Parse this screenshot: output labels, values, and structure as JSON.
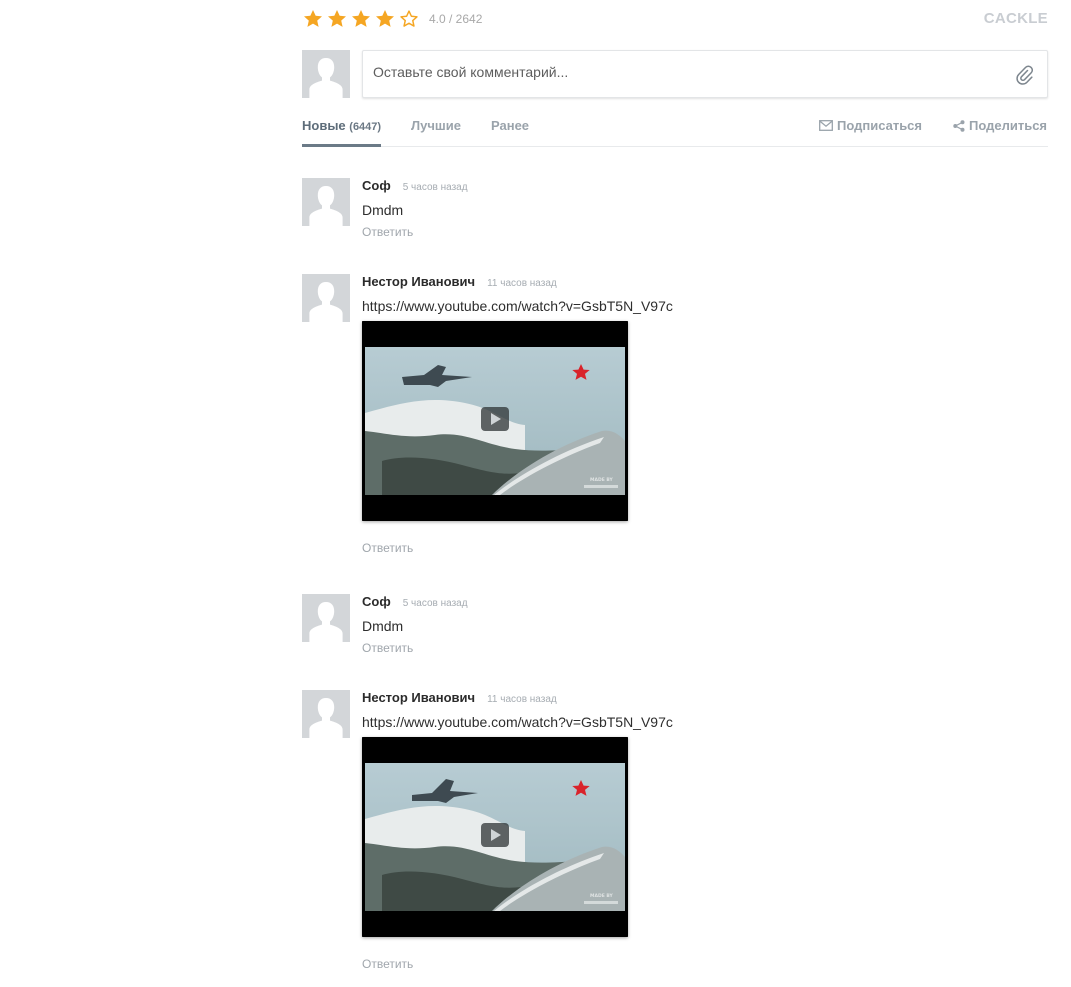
{
  "rating": {
    "value": 4,
    "max": 5,
    "text": "4.0 / 2642"
  },
  "brand": "CACKLE",
  "composer": {
    "placeholder": "Оставьте свой комментарий..."
  },
  "tabs": {
    "new_label": "Новые",
    "new_count": "(6447)",
    "best_label": "Лучшие",
    "earlier_label": "Ранее",
    "subscribe_label": "Подписаться",
    "share_label": "Поделиться"
  },
  "comments": [
    {
      "author": "Соф",
      "time": "5 часов назад",
      "text": "Dmdm",
      "reply": "Ответить"
    },
    {
      "author": "Нестор Иванович",
      "time": "11 часов назад",
      "text": "https://www.youtube.com/watch?v=GsbT5N_V97c",
      "reply": "Ответить",
      "video_watermark": "MADE BY"
    },
    {
      "author": "Соф",
      "time": "5 часов назад",
      "text": "Dmdm",
      "reply": "Ответить"
    },
    {
      "author": "Нестор Иванович",
      "time": "11 часов назад",
      "text": "https://www.youtube.com/watch?v=GsbT5N_V97c",
      "reply": "Ответить",
      "video_watermark": "MADE BY"
    }
  ],
  "colors": {
    "star": "#f5a623",
    "tab_active": "#5e6d7a",
    "muted": "#a0a6ac",
    "avatar_bg": "#d3d6d9"
  },
  "icons": {
    "attach": "paperclip-icon",
    "subscribe": "envelope-icon",
    "share": "share-icon",
    "play": "play-icon"
  }
}
